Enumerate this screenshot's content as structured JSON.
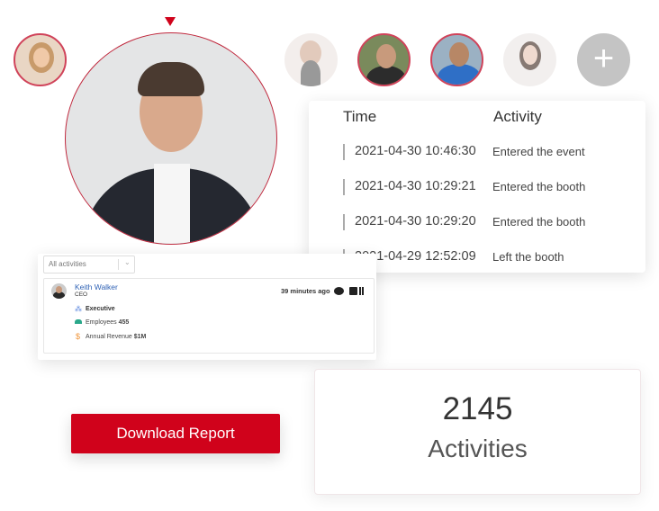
{
  "colors": {
    "accent": "#d0021b",
    "avatar_border": "#d0435a",
    "add_button": "#c4c4c4"
  },
  "avatars": [
    {
      "name": "attendee-1",
      "selected": true
    },
    {
      "name": "attendee-2",
      "selected": false
    },
    {
      "name": "attendee-3",
      "selected": true
    },
    {
      "name": "attendee-4",
      "selected": true
    },
    {
      "name": "attendee-5",
      "selected": false
    }
  ],
  "add_icon": "+",
  "activity_table": {
    "headers": {
      "time": "Time",
      "activity": "Activity"
    },
    "rows": [
      {
        "time": "2021-04-30 10:46:30",
        "activity": "Entered the event"
      },
      {
        "time": "2021-04-30 10:29:21",
        "activity": "Entered the booth"
      },
      {
        "time": "2021-04-30 10:29:20",
        "activity": "Entered the booth"
      },
      {
        "time": "2021-04-29 12:52:09",
        "activity": "Left the booth"
      }
    ]
  },
  "activity_feed": {
    "filter": "All activities",
    "contact": {
      "name": "Keith Walker",
      "title": "CEO",
      "time_ago": "39 minutes ago",
      "seniority": "Executive",
      "employees_label": "Employees",
      "employees": "455",
      "revenue_label": "Annual Revenue",
      "revenue": "$1M"
    }
  },
  "download_button": "Download Report",
  "stats": {
    "count": "2145",
    "label": "Activities"
  }
}
